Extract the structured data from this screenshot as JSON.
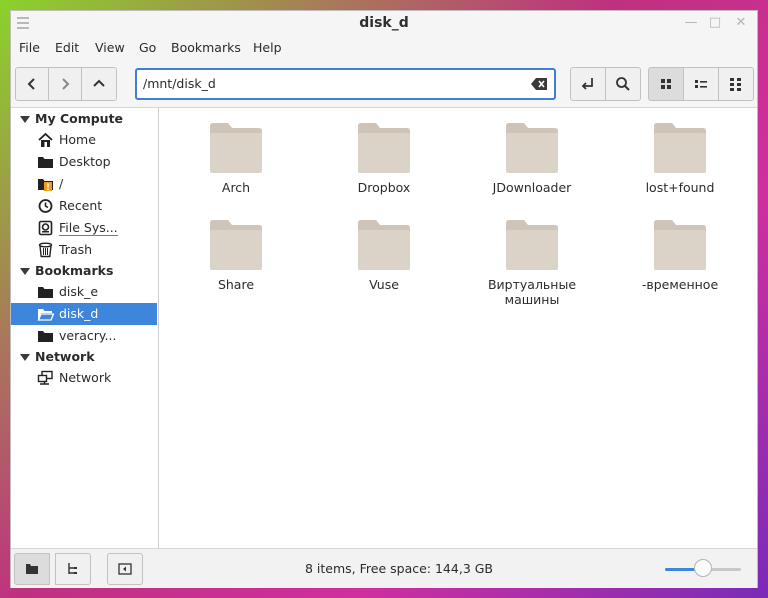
{
  "window": {
    "title": "disk_d"
  },
  "menubar": {
    "items": [
      "File",
      "Edit",
      "View",
      "Go",
      "Bookmarks",
      "Help"
    ]
  },
  "toolbar": {
    "path_value": "/mnt/disk_d",
    "icons": {
      "back": "chevron-left-icon",
      "forward": "chevron-right-icon",
      "up": "chevron-up-icon",
      "clear": "backspace-clear-icon",
      "open_terminal": "return-arrow-icon",
      "search": "search-icon",
      "view_icons": "grid-view-icon",
      "view_compact": "compact-list-icon",
      "view_list": "detailed-list-icon"
    }
  },
  "sidebar": {
    "sections": [
      {
        "heading": "My Compute",
        "items": [
          {
            "label": "Home",
            "icon": "home-icon"
          },
          {
            "label": "Desktop",
            "icon": "folder-icon"
          },
          {
            "label": "/",
            "icon": "root-folder-warning-icon"
          },
          {
            "label": "Recent",
            "icon": "clock-icon"
          },
          {
            "label": "File Sys...",
            "icon": "drive-icon"
          },
          {
            "label": "Trash",
            "icon": "trash-icon"
          }
        ]
      },
      {
        "heading": "Bookmarks",
        "items": [
          {
            "label": "disk_e",
            "icon": "folder-icon"
          },
          {
            "label": "disk_d",
            "icon": "folder-open-icon",
            "selected": true
          },
          {
            "label": "veracry...",
            "icon": "folder-icon"
          }
        ]
      },
      {
        "heading": "Network",
        "items": [
          {
            "label": "Network",
            "icon": "network-icon"
          }
        ]
      }
    ]
  },
  "files": [
    {
      "name": "Arch"
    },
    {
      "name": "Dropbox"
    },
    {
      "name": "JDownloader"
    },
    {
      "name": "lost+found"
    },
    {
      "name": "Share"
    },
    {
      "name": "Vuse"
    },
    {
      "name": "Виртуальные машины"
    },
    {
      "name": "-временное"
    }
  ],
  "status": {
    "text": "8 items, Free space: 144,3  GB",
    "zoom_fraction": 0.5
  },
  "colors": {
    "accent": "#3d86db",
    "folder": "#dcd3c8",
    "folder_tab": "#cfc4b8"
  }
}
